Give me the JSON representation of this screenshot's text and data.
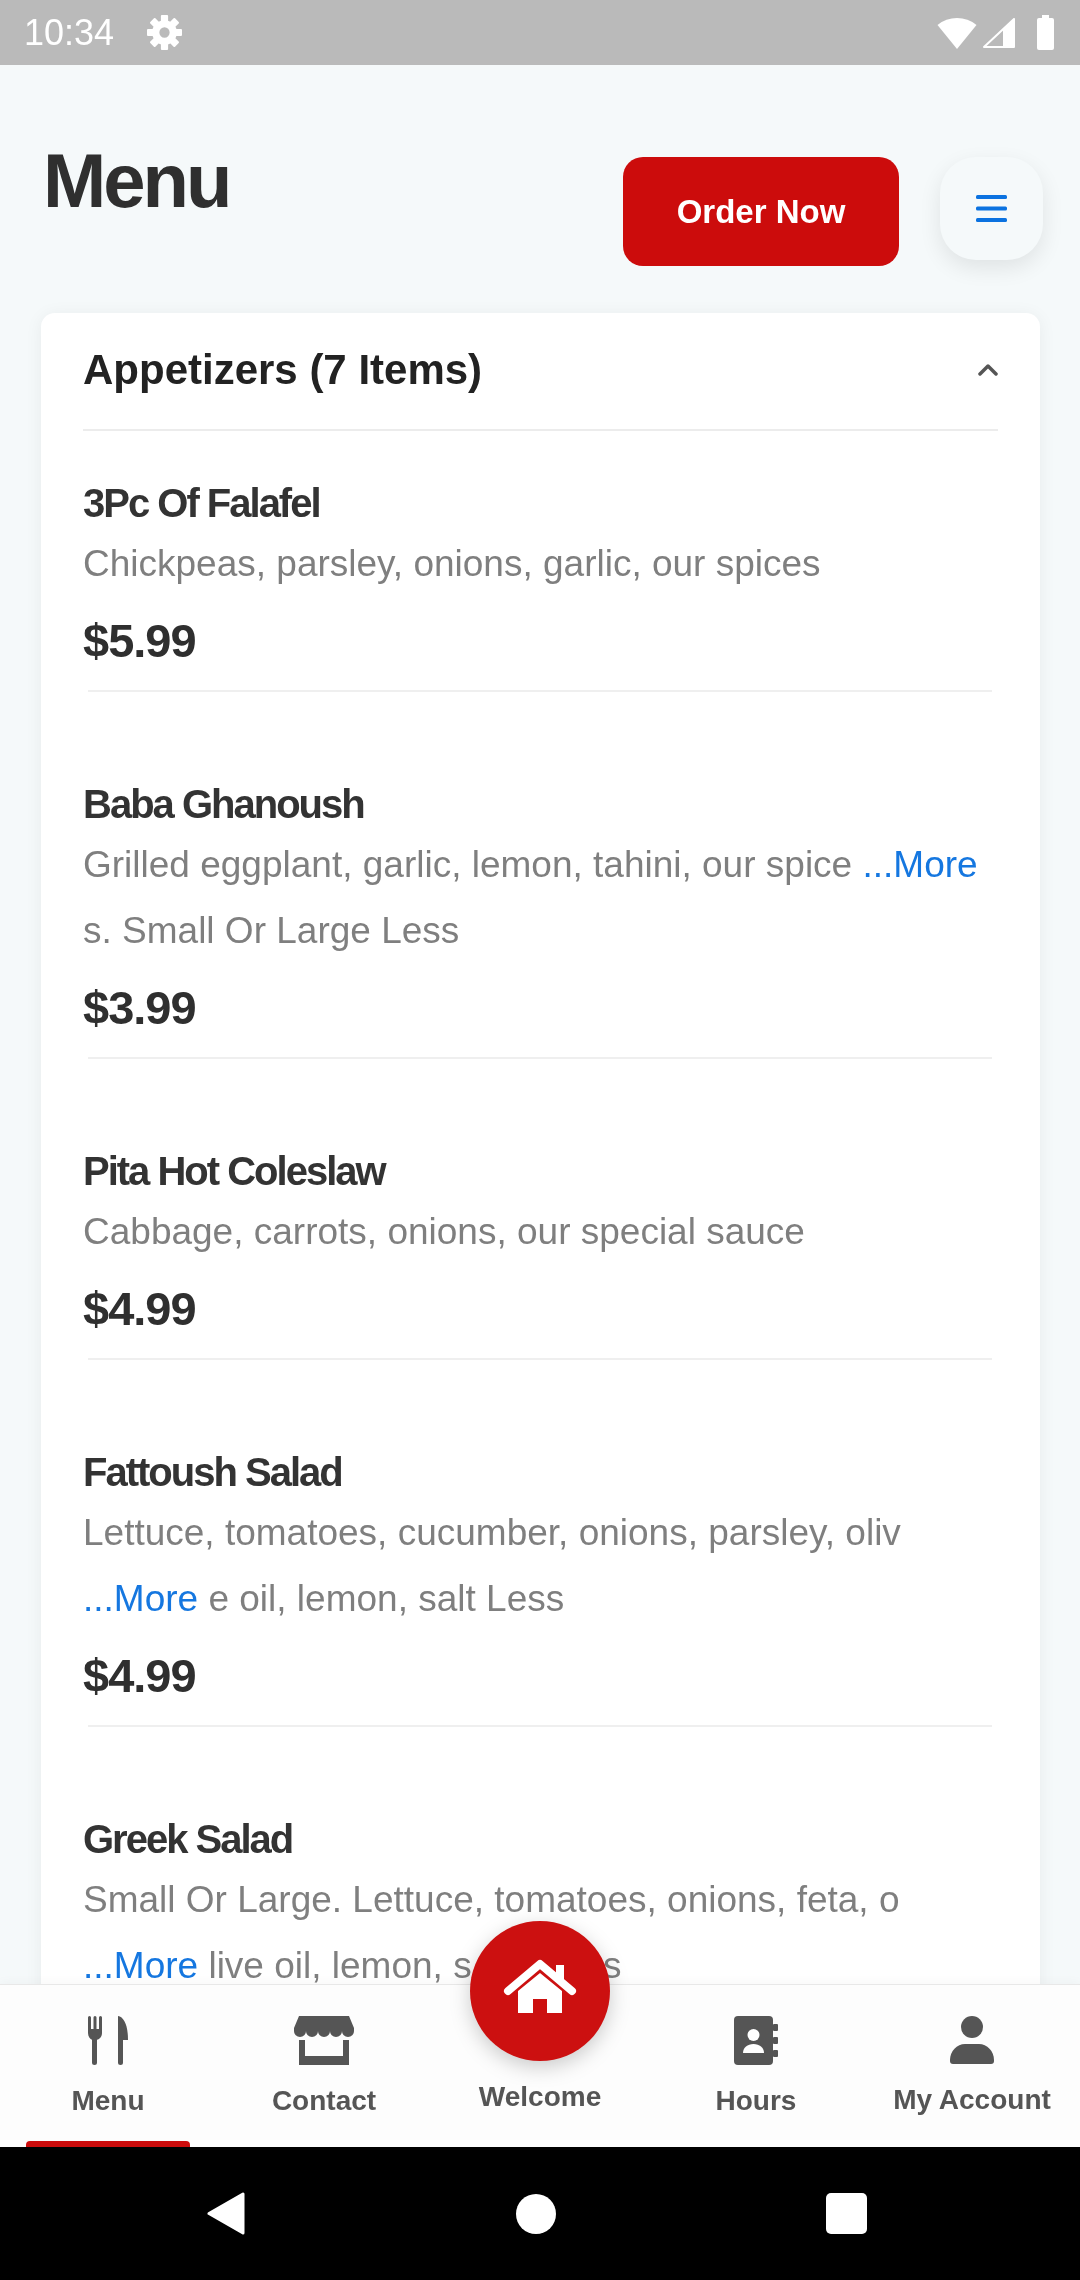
{
  "status_bar": {
    "time": "10:34"
  },
  "header": {
    "title": "Menu",
    "order_button": "Order Now"
  },
  "menu_section": {
    "title": "Appetizers (7 Items)",
    "expanded": true,
    "items": [
      {
        "name": "3Pc Of Falafel",
        "description_lines": [
          [
            {
              "kind": "text",
              "text": "Chickpeas, parsley, onions, garlic, our spices"
            }
          ]
        ],
        "price": "$5.99"
      },
      {
        "name": "Baba Ghanoush",
        "description_lines": [
          [
            {
              "kind": "text",
              "text": "Grilled eggplant, garlic, lemon, tahini, our spice"
            },
            {
              "kind": "link",
              "text": "...More"
            }
          ],
          [
            {
              "kind": "text",
              "text": "s. Small Or Large Less"
            }
          ]
        ],
        "price": "$3.99"
      },
      {
        "name": "Pita Hot Coleslaw",
        "description_lines": [
          [
            {
              "kind": "text",
              "text": "Cabbage, carrots, onions, our special sauce"
            }
          ]
        ],
        "price": "$4.99"
      },
      {
        "name": "Fattoush Salad",
        "description_lines": [
          [
            {
              "kind": "text",
              "text": "Lettuce, tomatoes, cucumber, onions, parsley, oliv"
            }
          ],
          [
            {
              "kind": "link",
              "text": "...More"
            },
            {
              "kind": "text",
              "text": "e oil, lemon, salt Less"
            }
          ]
        ],
        "price": "$4.99"
      },
      {
        "name": "Greek Salad",
        "description_lines": [
          [
            {
              "kind": "text",
              "text": "Small Or Large. Lettuce, tomatoes, onions, feta, o"
            }
          ],
          [
            {
              "kind": "link",
              "text": "...More"
            },
            {
              "kind": "text",
              "text": "live oil, lemon, s"
            },
            {
              "kind": "covered"
            },
            {
              "kind": "text",
              "text": "s"
            }
          ]
        ]
      }
    ]
  },
  "bottom_nav": {
    "items": [
      {
        "kind": "tab",
        "label": "Menu",
        "selected": true
      },
      {
        "kind": "tab",
        "label": "Contact",
        "selected": false
      },
      {
        "kind": "fab",
        "label": "Welcome",
        "selected": false
      },
      {
        "kind": "tab",
        "label": "Hours",
        "selected": false
      },
      {
        "kind": "tab",
        "label": "My Account",
        "selected": false
      }
    ]
  }
}
